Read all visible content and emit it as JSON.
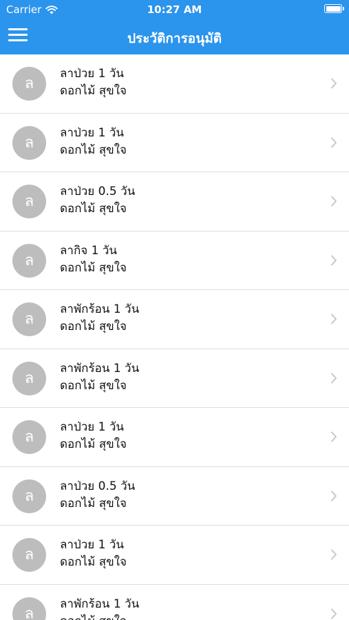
{
  "status_bar": {
    "carrier": "Carrier",
    "time": "10:27 AM",
    "wifi_icon": "wifi-icon",
    "battery_icon": "battery-icon"
  },
  "header": {
    "menu_icon": "hamburger-menu-icon",
    "title": "ประวัติการอนุมัติ"
  },
  "colors": {
    "header_bg": "#2b94ec",
    "avatar_bg": "#bdbdbd",
    "chevron": "#c7c7cc"
  },
  "items": [
    {
      "avatar": "ล",
      "title": "ลาป่วย 1 วัน",
      "name": "ดอกไม้ สุขใจ"
    },
    {
      "avatar": "ล",
      "title": "ลาป่วย 1 วัน",
      "name": "ดอกไม้ สุขใจ"
    },
    {
      "avatar": "ล",
      "title": "ลาป่วย 0.5 วัน",
      "name": "ดอกไม้ สุขใจ"
    },
    {
      "avatar": "ล",
      "title": "ลากิจ 1 วัน",
      "name": "ดอกไม้ สุขใจ"
    },
    {
      "avatar": "ล",
      "title": "ลาพักร้อน 1 วัน",
      "name": "ดอกไม้ สุขใจ"
    },
    {
      "avatar": "ล",
      "title": "ลาพักร้อน 1 วัน",
      "name": "ดอกไม้ สุขใจ"
    },
    {
      "avatar": "ล",
      "title": "ลาป่วย 1 วัน",
      "name": "ดอกไม้ สุขใจ"
    },
    {
      "avatar": "ล",
      "title": "ลาป่วย 0.5 วัน",
      "name": "ดอกไม้ สุขใจ"
    },
    {
      "avatar": "ล",
      "title": "ลาป่วย 1 วัน",
      "name": "ดอกไม้ สุขใจ"
    },
    {
      "avatar": "ล",
      "title": "ลาพักร้อน 1 วัน",
      "name": "ดอกไม้ สุขใจ"
    }
  ]
}
